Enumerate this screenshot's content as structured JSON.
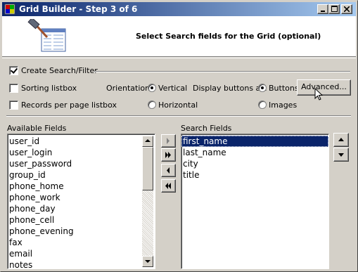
{
  "window": {
    "title": "Grid Builder - Step 3 of 6",
    "minimize_label": "_",
    "maximize_label": "□",
    "close_label": "×"
  },
  "header": {
    "title": "Select Search fields for the Grid (optional)",
    "icon": "builder-hammer-icon"
  },
  "options": {
    "create_search": {
      "label": "Create Search/Filter",
      "checked": true
    },
    "sorting_listbox": {
      "label": "Sorting listbox",
      "checked": false
    },
    "records_per_page": {
      "label": "Records per page listbox",
      "checked": false
    },
    "orientation_label": "Orientation:",
    "orientation_options": [
      {
        "label": "Vertical",
        "selected": true
      },
      {
        "label": "Horizontal",
        "selected": false
      }
    ],
    "display_buttons_label": "Display buttons as:",
    "display_options": [
      {
        "label": "Buttons",
        "selected": true
      },
      {
        "label": "Images",
        "selected": false
      }
    ],
    "advanced_button": "Advanced..."
  },
  "available_fields": {
    "label": "Available Fields",
    "items": [
      "user_id",
      "user_login",
      "user_password",
      "group_id",
      "phone_home",
      "phone_work",
      "phone_day",
      "phone_cell",
      "phone_evening",
      "fax",
      "email",
      "notes"
    ]
  },
  "search_fields": {
    "label": "Search Fields",
    "items": [
      "first_name",
      "last_name",
      "city",
      "title"
    ],
    "selected_index": 0
  },
  "transfer_buttons": [
    "move-right-icon",
    "move-all-right-icon",
    "move-left-icon",
    "move-all-left-icon"
  ],
  "order_buttons": [
    "move-up-icon",
    "move-down-icon"
  ]
}
